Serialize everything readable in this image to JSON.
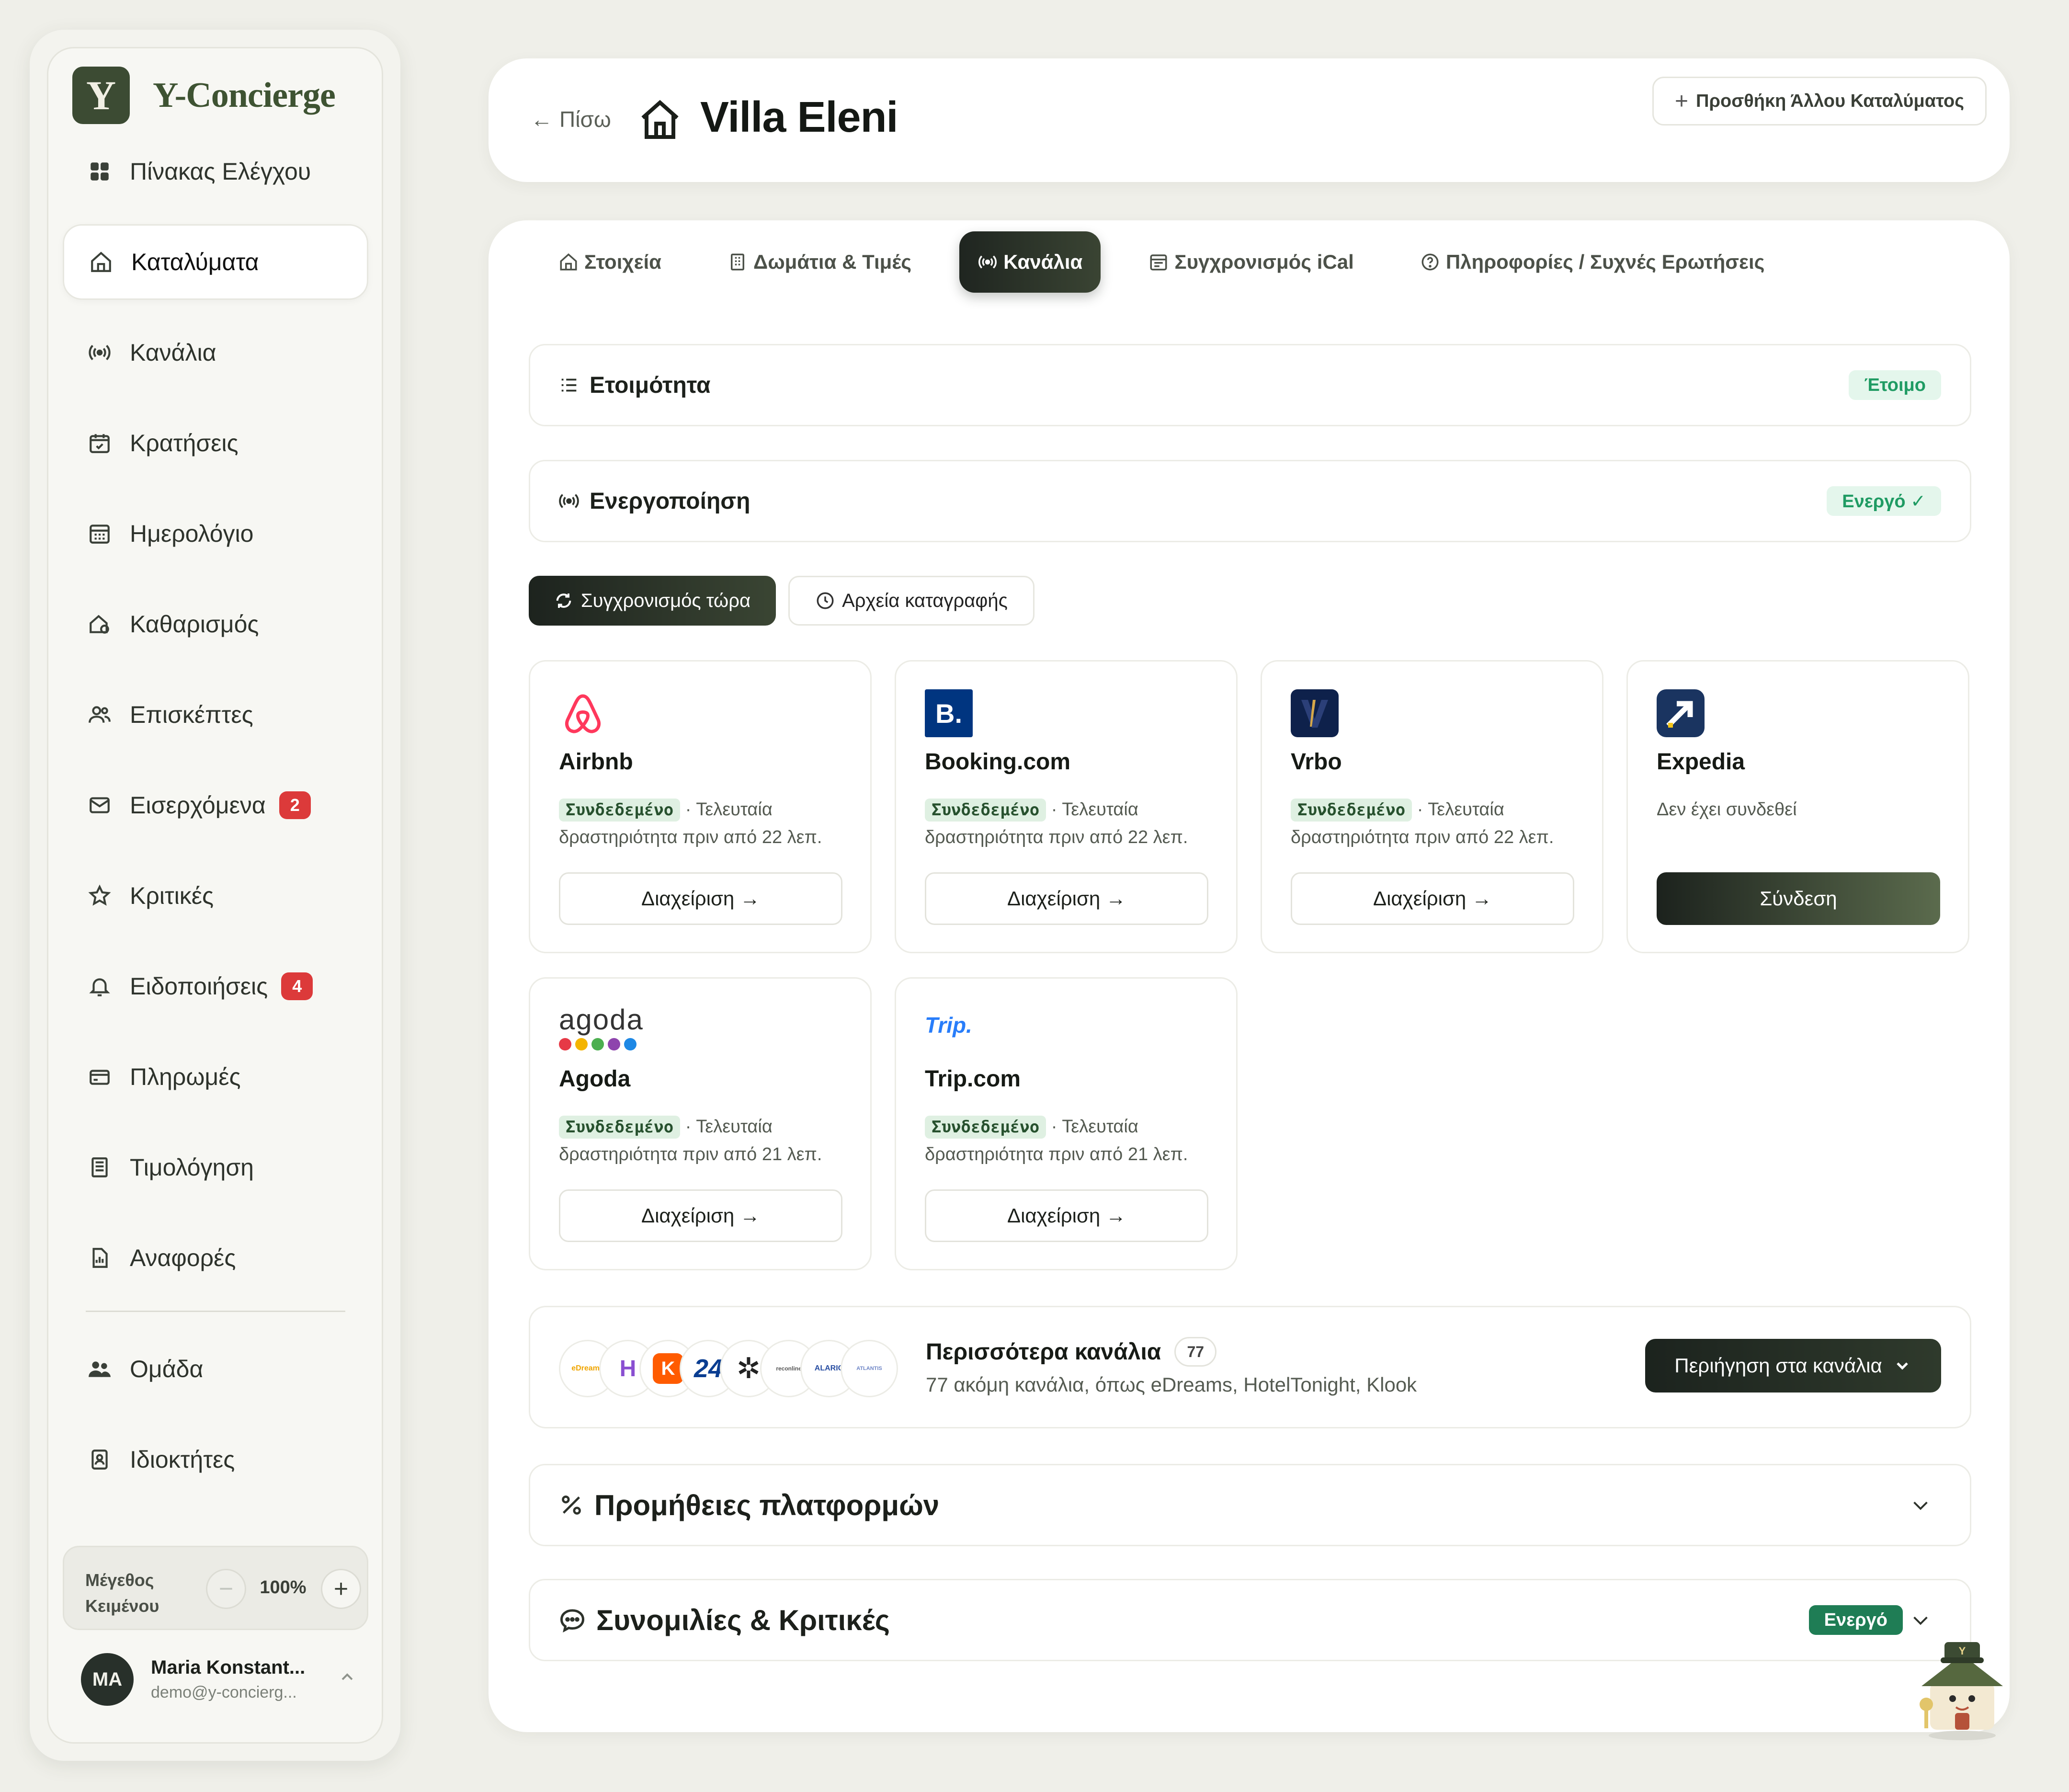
{
  "brand": {
    "logo_letter": "Y",
    "name": "Y-Concierge"
  },
  "nav": {
    "items": [
      {
        "label": "Πίνακας Ελέγχου",
        "icon": "dashboard-icon"
      },
      {
        "label": "Καταλύματα",
        "icon": "home-icon",
        "active": true
      },
      {
        "label": "Κανάλια",
        "icon": "broadcast-icon"
      },
      {
        "label": "Κρατήσεις",
        "icon": "calendar-check-icon"
      },
      {
        "label": "Ημερολόγιο",
        "icon": "calendar-icon"
      },
      {
        "label": "Καθαρισμός",
        "icon": "cleaning-icon"
      },
      {
        "label": "Επισκέπτες",
        "icon": "users-icon"
      },
      {
        "label": "Εισερχόμενα",
        "icon": "mail-icon",
        "badge": "2"
      },
      {
        "label": "Κριτικές",
        "icon": "star-icon"
      },
      {
        "label": "Ειδοποιήσεις",
        "icon": "bell-icon",
        "badge": "4"
      },
      {
        "label": "Πληρωμές",
        "icon": "credit-card-icon"
      },
      {
        "label": "Τιμολόγηση",
        "icon": "invoice-icon"
      },
      {
        "label": "Αναφορές",
        "icon": "report-icon"
      }
    ],
    "secondary": [
      {
        "label": "Ομάδα",
        "icon": "team-icon"
      },
      {
        "label": "Ιδιοκτήτες",
        "icon": "owner-icon"
      }
    ]
  },
  "text_size": {
    "label": "Μέγεθος Κειμένου",
    "value": "100%",
    "minus": "−",
    "plus": "+"
  },
  "user": {
    "initials": "MA",
    "name": "Maria Konstant...",
    "email": "demo@y-concierg..."
  },
  "header": {
    "back_label": "Πίσω",
    "title": "Villa Eleni",
    "add_property": "Προσθήκη Άλλου Καταλύματος"
  },
  "tabs": [
    {
      "label": "Στοιχεία",
      "icon": "home-icon"
    },
    {
      "label": "Δωμάτια & Τιμές",
      "icon": "building-icon"
    },
    {
      "label": "Κανάλια",
      "icon": "broadcast-icon",
      "active": true
    },
    {
      "label": "Συγχρονισμός iCal",
      "icon": "calendar-icon"
    },
    {
      "label": "Πληροφορίες / Συχνές Ερωτήσεις",
      "icon": "help-icon"
    }
  ],
  "readiness": {
    "title": "Ετοιμότητα",
    "status": "Έτοιμο"
  },
  "activation": {
    "title": "Ενεργοποίηση",
    "status": "Ενεργό ✓"
  },
  "actions": {
    "sync_now": "Συγχρονισμός τώρα",
    "logs": "Αρχεία καταγραφής"
  },
  "channels": [
    {
      "name": "Airbnb",
      "linked": "Συνδεδεμένο",
      "activity": "· Τελευταία δραστηριότητα πριν από 22 λεπ.",
      "button": "Διαχείριση →"
    },
    {
      "name": "Booking.com",
      "linked": "Συνδεδεμένο",
      "activity": "· Τελευταία δραστηριότητα πριν από 22 λεπ.",
      "button": "Διαχείριση →",
      "logo_text": "B."
    },
    {
      "name": "Vrbo",
      "linked": "Συνδεδεμένο",
      "activity": "· Τελευταία δραστηριότητα πριν από 22 λεπ.",
      "button": "Διαχείριση →"
    },
    {
      "name": "Expedia",
      "status": "Δεν έχει συνδεθεί",
      "button": "Σύνδεση"
    },
    {
      "name": "Agoda",
      "linked": "Συνδεδεμένο",
      "activity": "· Τελευταία δραστηριότητα πριν από 21 λεπ.",
      "button": "Διαχείριση →",
      "logo_text": "agoda"
    },
    {
      "name": "Trip.com",
      "linked": "Συνδεδεμένο",
      "activity": "· Τελευταία δραστηριότητα πριν από 21 λεπ.",
      "button": "Διαχείριση →",
      "logo_text": "Trip."
    }
  ],
  "more_channels": {
    "title": "Περισσότερα κανάλια",
    "count": "77",
    "subtitle": "77 ακόμη κανάλια, όπως eDreams, HotelTonight, Klook",
    "browse": "Περιήγηση στα κανάλια",
    "logos": [
      "eDreams",
      "H",
      "K",
      "24",
      "✲",
      "reconline",
      "ALARIC",
      "ATLANTIS"
    ]
  },
  "commissions": {
    "title": "Προμήθειες πλατφορμών"
  },
  "conversations": {
    "title": "Συνομιλίες & Κριτικές",
    "status": "Ενεργό"
  },
  "colors": {
    "accent_dark": "#1f2520",
    "brand_green": "#3e5332",
    "success_green": "#1f9b63",
    "badge_red": "#dc3a3a",
    "airbnb": "#ff385c",
    "booking": "#003580",
    "vrbo": "#0e214b",
    "expedia": "#1a3460",
    "trip": "#287dfa"
  }
}
